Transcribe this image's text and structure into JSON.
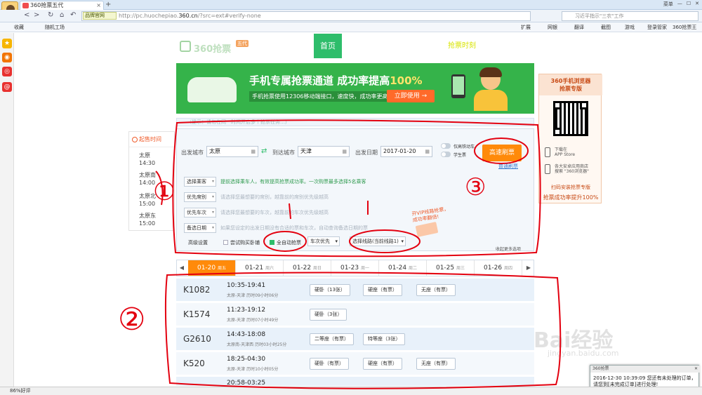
{
  "browser": {
    "tab_title": "360抢票五代",
    "new_tab": "+",
    "close_tab": "×",
    "window_controls": [
      "菜单",
      "—",
      "☐",
      "✕"
    ],
    "url_badge": "品牌官网",
    "url_host": "pc.huochepiao.",
    "url_bold": "360.cn",
    "url_rest": "/?src=ext#verify-none",
    "url_prefix": "http://",
    "search_placeholder": "习近平指示\"三农\"工作",
    "bookmarks_left": [
      "收藏",
      "随机工场"
    ],
    "bookmarks_right": [
      "扩展",
      "网银",
      "翻译",
      "截图",
      "游戏",
      "登录管家",
      "360抢票王"
    ],
    "status_text": "86%好评"
  },
  "site": {
    "logo_text": "360抢票",
    "logo_tag": "五代",
    "nav_home": "首页",
    "nav_schedule": "抢票时刻"
  },
  "banner": {
    "headline": "手机专属抢票通道 成功率提高",
    "headline_pct": "100%",
    "subline": "手机抢票使用12306移动端接口，速度快，成功率更高",
    "button": "立即使用 →"
  },
  "qr_panel": {
    "title": "360手机浏览器",
    "subtitle": "抢票专版",
    "row1_a": "下载在",
    "row1_b": "APP Store",
    "row2_a": "各大安卓应用商店",
    "row2_b": "搜索 \"360浏览器\"",
    "foot1": "扫码安装抢票专版",
    "foot2": "抢票成功率提升100%"
  },
  "notice": "（提示：请勿在同一时间开启多个抢票任务…）",
  "search": {
    "from_label": "出发城市",
    "from_value": "太原",
    "to_label": "到达城市",
    "to_value": "天津",
    "date_label": "出发日期",
    "date_value": "2017-01-20",
    "toggle1": "仅高铁动车",
    "toggle2": "学生票",
    "fast_button": "高速刷票",
    "normal_button": "普通刷票",
    "rows": [
      {
        "btn": "选择乘客",
        "text": "提前选择乘车人，有效提高抢票成功率。一次购票最多选择5名乘客"
      },
      {
        "btn": "优先席别",
        "text": "请选择您最想要的席别，越靠前的席别优先级越高"
      },
      {
        "btn": "优先车次",
        "text": "请选择您最想要的车次，越靠前的车次优先级越高"
      },
      {
        "btn": "备选日期",
        "text": "如果您设定的出发日期没有合适的票和车次，自动查询备选日期的票"
      }
    ],
    "adv_label": "高级设置",
    "opt_try": "尝试购买卧铺",
    "opt_auto": "全自动抢票",
    "opt_order": "车次优先",
    "opt_line": "选择线路(当前线路1)",
    "vip_text": "开VIP线路抢票，成功率翻倍!",
    "collapse": "收起更多选项"
  },
  "left_list": {
    "header": "起售时间",
    "items": [
      {
        "station": "太原",
        "time": "14:30"
      },
      {
        "station": "太原南",
        "time": "14:00"
      },
      {
        "station": "太原北",
        "time": "15:00"
      },
      {
        "station": "太原东",
        "time": "15:00"
      }
    ]
  },
  "date_tabs": [
    {
      "date": "01-20",
      "week": "周五"
    },
    {
      "date": "01-21",
      "week": "周六"
    },
    {
      "date": "01-22",
      "week": "周日"
    },
    {
      "date": "01-23",
      "week": "周一"
    },
    {
      "date": "01-24",
      "week": "周二"
    },
    {
      "date": "01-25",
      "week": "周三"
    },
    {
      "date": "01-26",
      "week": "周四"
    }
  ],
  "date_arrows": [
    "◀",
    "▶"
  ],
  "trains": [
    {
      "code": "K1082",
      "time": "10:35-19:41",
      "sub": "太原-天津 历时09小时06分",
      "seats": [
        "硬卧（13张）",
        "硬座（有票）",
        "无座（有票）"
      ]
    },
    {
      "code": "K1574",
      "time": "11:23-19:12",
      "sub": "太原-天津 历时07小时49分",
      "seats": [
        "硬卧（3张）"
      ]
    },
    {
      "code": "G2610",
      "time": "14:43-18:08",
      "sub": "太原南-天津西 历时03小时25分",
      "seats": [
        "二等座（有票）",
        "特等座（3张）"
      ]
    },
    {
      "code": "K520",
      "time": "18:25-04:30",
      "sub": "太原-天津 历时10小时05分",
      "seats": [
        "硬卧（有票）",
        "硬座（有票）",
        "无座（有票）"
      ]
    },
    {
      "code": "",
      "time": "20:58-03:25",
      "sub": "",
      "seats": []
    }
  ],
  "popup": {
    "title": "360抢票",
    "close": "✕",
    "body": "2016-12-30 10:39:09 您还有未处理的订单，请您到[未完成订单]进行处理!"
  },
  "annotations": [
    "①",
    "②",
    "③"
  ],
  "watermark": {
    "text": "Bai经验",
    "url": "jingyan.baidu.com"
  },
  "colors": {
    "accent_green": "#2ebd6b",
    "accent_orange": "#ff8a0a",
    "annotation_red": "#e3000f"
  }
}
